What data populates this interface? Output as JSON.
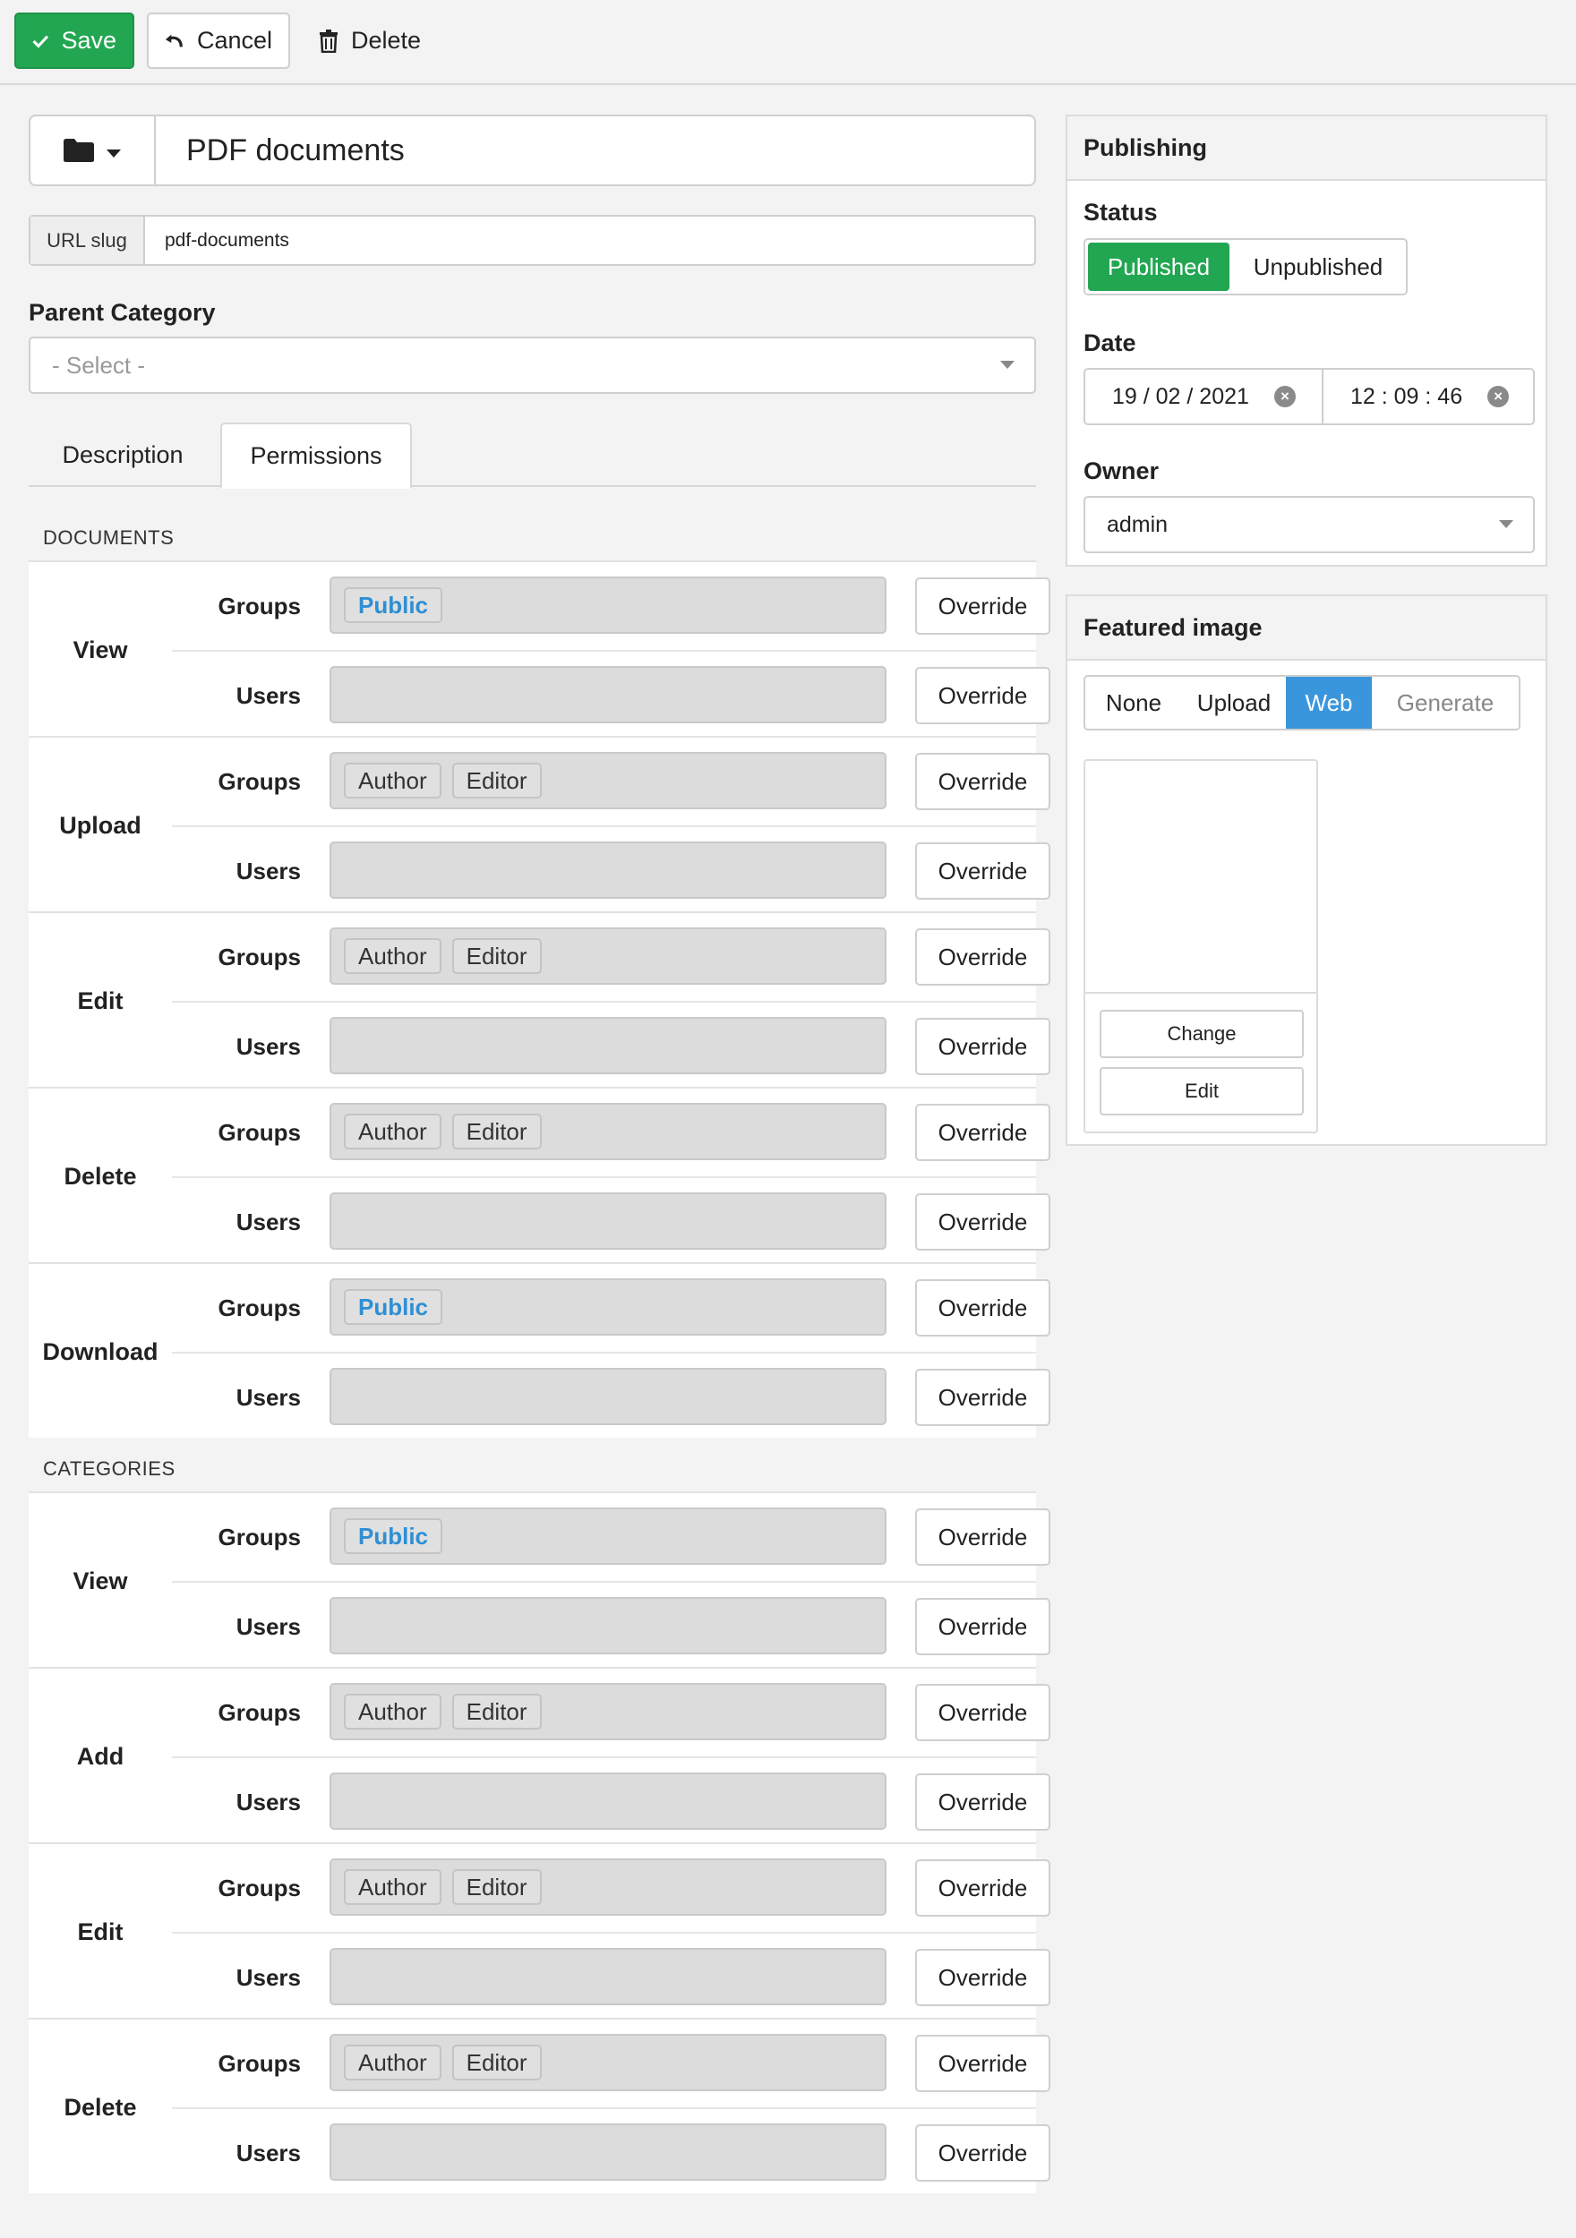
{
  "toolbar": {
    "save_label": "Save",
    "cancel_label": "Cancel",
    "delete_label": "Delete"
  },
  "title": {
    "value": "PDF documents"
  },
  "slug": {
    "label": "URL slug",
    "value": "pdf-documents"
  },
  "parent_category": {
    "label": "Parent Category",
    "placeholder": "- Select -"
  },
  "tabs": {
    "description": "Description",
    "permissions": "Permissions"
  },
  "permissions": {
    "row_groups_label": "Groups",
    "row_users_label": "Users",
    "override_label": "Override",
    "documents": {
      "heading": "DOCUMENTS",
      "actions": [
        {
          "name": "View",
          "groups": [
            "Public"
          ],
          "users": []
        },
        {
          "name": "Upload",
          "groups": [
            "Author",
            "Editor"
          ],
          "users": []
        },
        {
          "name": "Edit",
          "groups": [
            "Author",
            "Editor"
          ],
          "users": []
        },
        {
          "name": "Delete",
          "groups": [
            "Author",
            "Editor"
          ],
          "users": []
        },
        {
          "name": "Download",
          "groups": [
            "Public"
          ],
          "users": []
        }
      ]
    },
    "categories": {
      "heading": "CATEGORIES",
      "actions": [
        {
          "name": "View",
          "groups": [
            "Public"
          ],
          "users": []
        },
        {
          "name": "Add",
          "groups": [
            "Author",
            "Editor"
          ],
          "users": []
        },
        {
          "name": "Edit",
          "groups": [
            "Author",
            "Editor"
          ],
          "users": []
        },
        {
          "name": "Delete",
          "groups": [
            "Author",
            "Editor"
          ],
          "users": []
        }
      ]
    }
  },
  "publishing": {
    "heading": "Publishing",
    "status_label": "Status",
    "status_options": [
      "Published",
      "Unpublished"
    ],
    "status_selected": "Published",
    "date_label": "Date",
    "date_value": "19 / 02 / 2021",
    "time_value": "12 : 09 : 46",
    "owner_label": "Owner",
    "owner_value": "admin"
  },
  "featured_image": {
    "heading": "Featured image",
    "options": [
      "None",
      "Upload",
      "Web",
      "Generate"
    ],
    "selected": "Web",
    "change_label": "Change",
    "edit_label": "Edit"
  },
  "colors": {
    "save_green": "#22a652",
    "active_blue": "#3a96dc",
    "public_tag_blue": "#2e8fd4"
  }
}
